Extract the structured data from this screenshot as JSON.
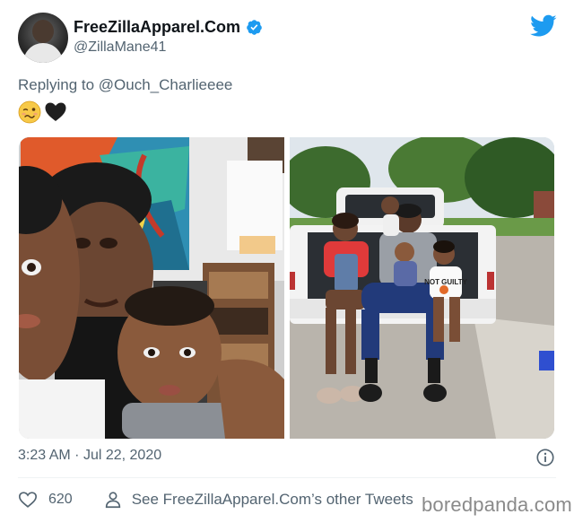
{
  "tweet": {
    "display_name": "FreeZillaApparel.Com",
    "handle": "@ZillaMane41",
    "reply_prefix": "Replying to",
    "reply_mention": "@Ouch_Charlieeee",
    "emojis": [
      "woozy-face",
      "black-heart"
    ],
    "time": "3:23 AM",
    "separator": "·",
    "date": "Jul 22, 2020",
    "like_count": "620",
    "see_more": "See FreeZillaApparel.Com’s other Tweets"
  },
  "photos": {
    "right_shirt_text": "NOT GUILTY"
  },
  "colors": {
    "brand": "#1d9bf0",
    "text_secondary": "#536471",
    "text_primary": "#0f1419"
  },
  "watermark": "boredpanda.com"
}
